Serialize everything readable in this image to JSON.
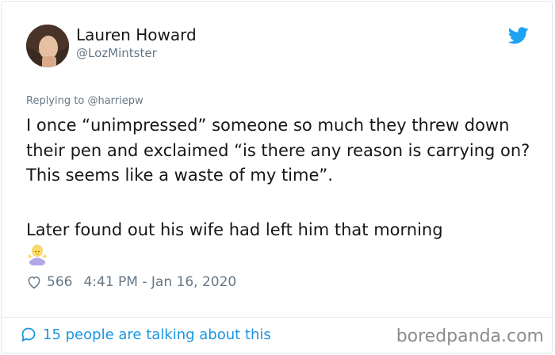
{
  "author": {
    "name": "Lauren Howard",
    "handle": "@LozMintster"
  },
  "reply": {
    "prefix": "Replying to",
    "mention": "@harriepw"
  },
  "tweet": {
    "paragraph1": "I once “unimpressed” someone so much they threw down their pen and exclaimed “is there any reason is carrying on? This seems like a waste of my time”.",
    "paragraph2": "Later found out his wife had left him that morning",
    "emoji": "woman-shrugging-emoji"
  },
  "meta": {
    "likes": "566",
    "timestamp": "4:41 PM - Jan 16, 2020"
  },
  "footer": {
    "conversation": "15 people are talking about this"
  },
  "watermark": "boredpanda.com",
  "colors": {
    "twitter_blue": "#1da1f2",
    "link_blue": "#1b95e0",
    "secondary_text": "#657786",
    "primary_text": "#14171a"
  },
  "icons": [
    "twitter-bird-icon",
    "heart-icon",
    "speech-bubble-icon"
  ]
}
